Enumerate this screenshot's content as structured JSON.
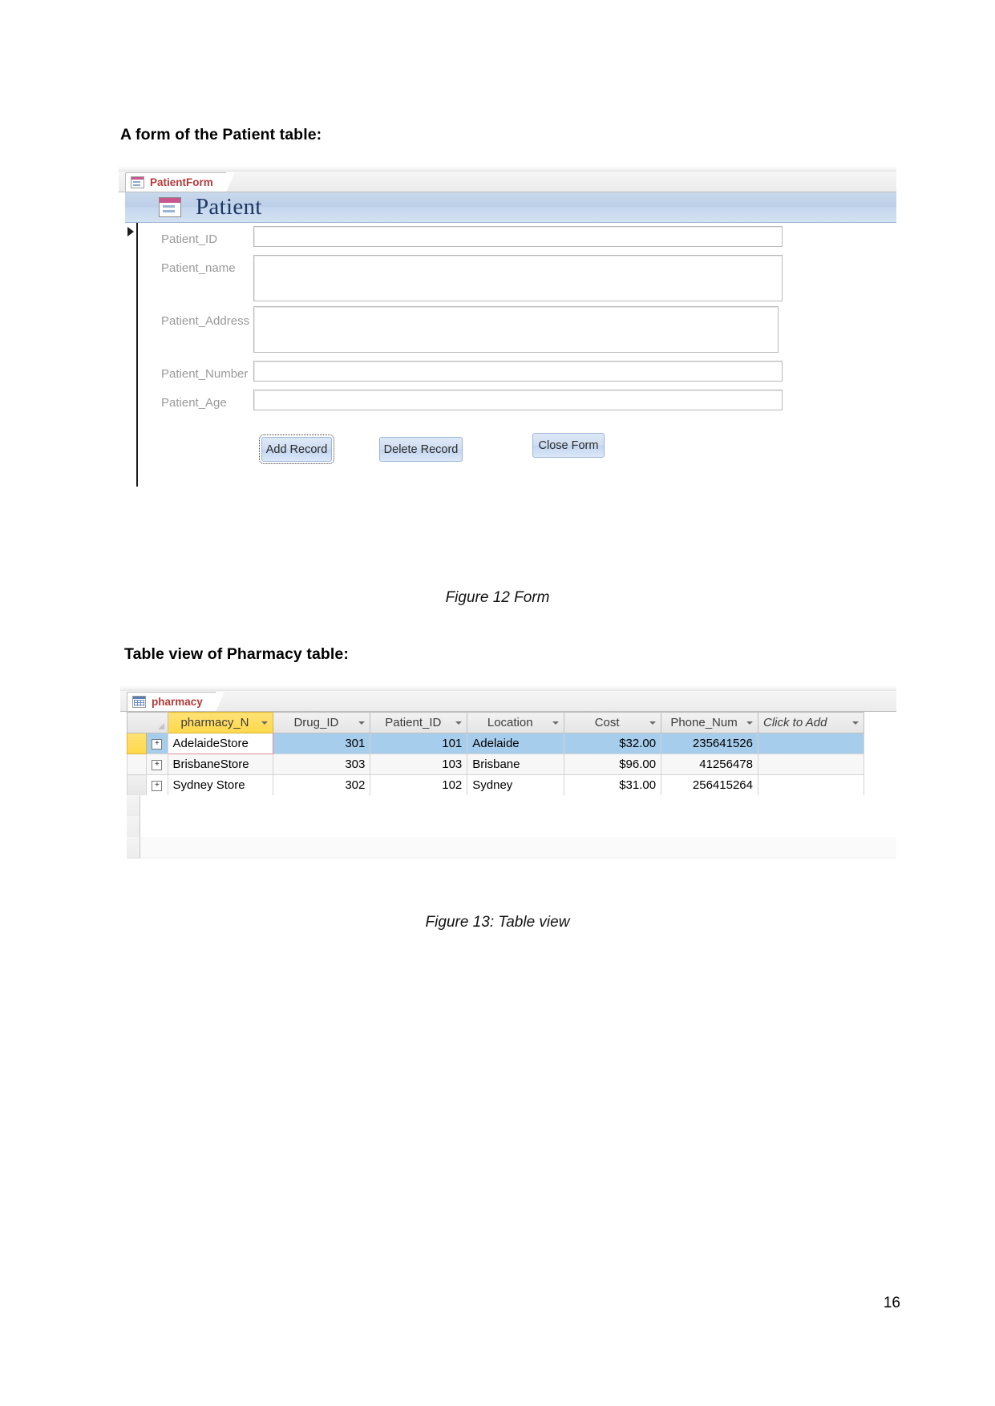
{
  "document": {
    "page_number": "16",
    "headings": {
      "form_section": "A form of the Patient table:",
      "table_section": "Table view of Pharmacy table:"
    },
    "captions": {
      "figure_12": "Figure 12 Form",
      "figure_13": "Figure 13: Table view"
    }
  },
  "form_screenshot": {
    "tab": {
      "label": "PatientForm",
      "icon": "form-icon"
    },
    "header": {
      "title": "Patient",
      "icon": "form-icon"
    },
    "fields": [
      {
        "label": "Patient_ID",
        "value": "",
        "type": "single-line"
      },
      {
        "label": "Patient_name",
        "value": "",
        "type": "multi-line"
      },
      {
        "label": "Patient_Address",
        "value": "",
        "type": "multi-line"
      },
      {
        "label": "Patient_Number",
        "value": "",
        "type": "single-line"
      },
      {
        "label": "Patient_Age",
        "value": "",
        "type": "single-line"
      }
    ],
    "buttons": [
      {
        "label": "Add Record",
        "focused": true
      },
      {
        "label": "Delete Record",
        "focused": false
      },
      {
        "label": "Close Form",
        "focused": false
      }
    ],
    "colors": {
      "header_band": "#c4d6ec",
      "header_title": "#1f3864",
      "tab_label": "#b33a3a",
      "label_text": "#9a9a9a",
      "button_face": "#cfdef2"
    }
  },
  "table_screenshot": {
    "tab": {
      "label": "pharmacy",
      "icon": "table-icon"
    },
    "columns": [
      {
        "label": "pharmacy_N",
        "selected": true,
        "align": "left"
      },
      {
        "label": "Drug_ID",
        "selected": false,
        "align": "right"
      },
      {
        "label": "Patient_ID",
        "selected": false,
        "align": "right"
      },
      {
        "label": "Location",
        "selected": false,
        "align": "left"
      },
      {
        "label": "Cost",
        "selected": false,
        "align": "right"
      },
      {
        "label": "Phone_Num",
        "selected": false,
        "align": "right"
      },
      {
        "label": "Click to Add",
        "selected": false,
        "align": "left"
      }
    ],
    "rows": [
      {
        "selected": true,
        "focus_cell": 0,
        "cells": [
          "AdelaideStore",
          "301",
          "101",
          "Adelaide",
          "$32.00",
          "235641526",
          ""
        ]
      },
      {
        "selected": false,
        "focus_cell": -1,
        "cells": [
          "BrisbaneStore",
          "303",
          "103",
          "Brisbane",
          "$96.00",
          "41256478",
          ""
        ]
      },
      {
        "selected": false,
        "focus_cell": -1,
        "cells": [
          "Sydney Store",
          "302",
          "102",
          "Sydney",
          "$31.00",
          "256415264",
          ""
        ]
      }
    ],
    "new_record_marker": "✳",
    "colors": {
      "selected_row": "#a7cdec",
      "selected_column_header": "#ffd84a",
      "focus_cell_border": "#e08a98",
      "tab_label": "#b33a3a"
    }
  }
}
